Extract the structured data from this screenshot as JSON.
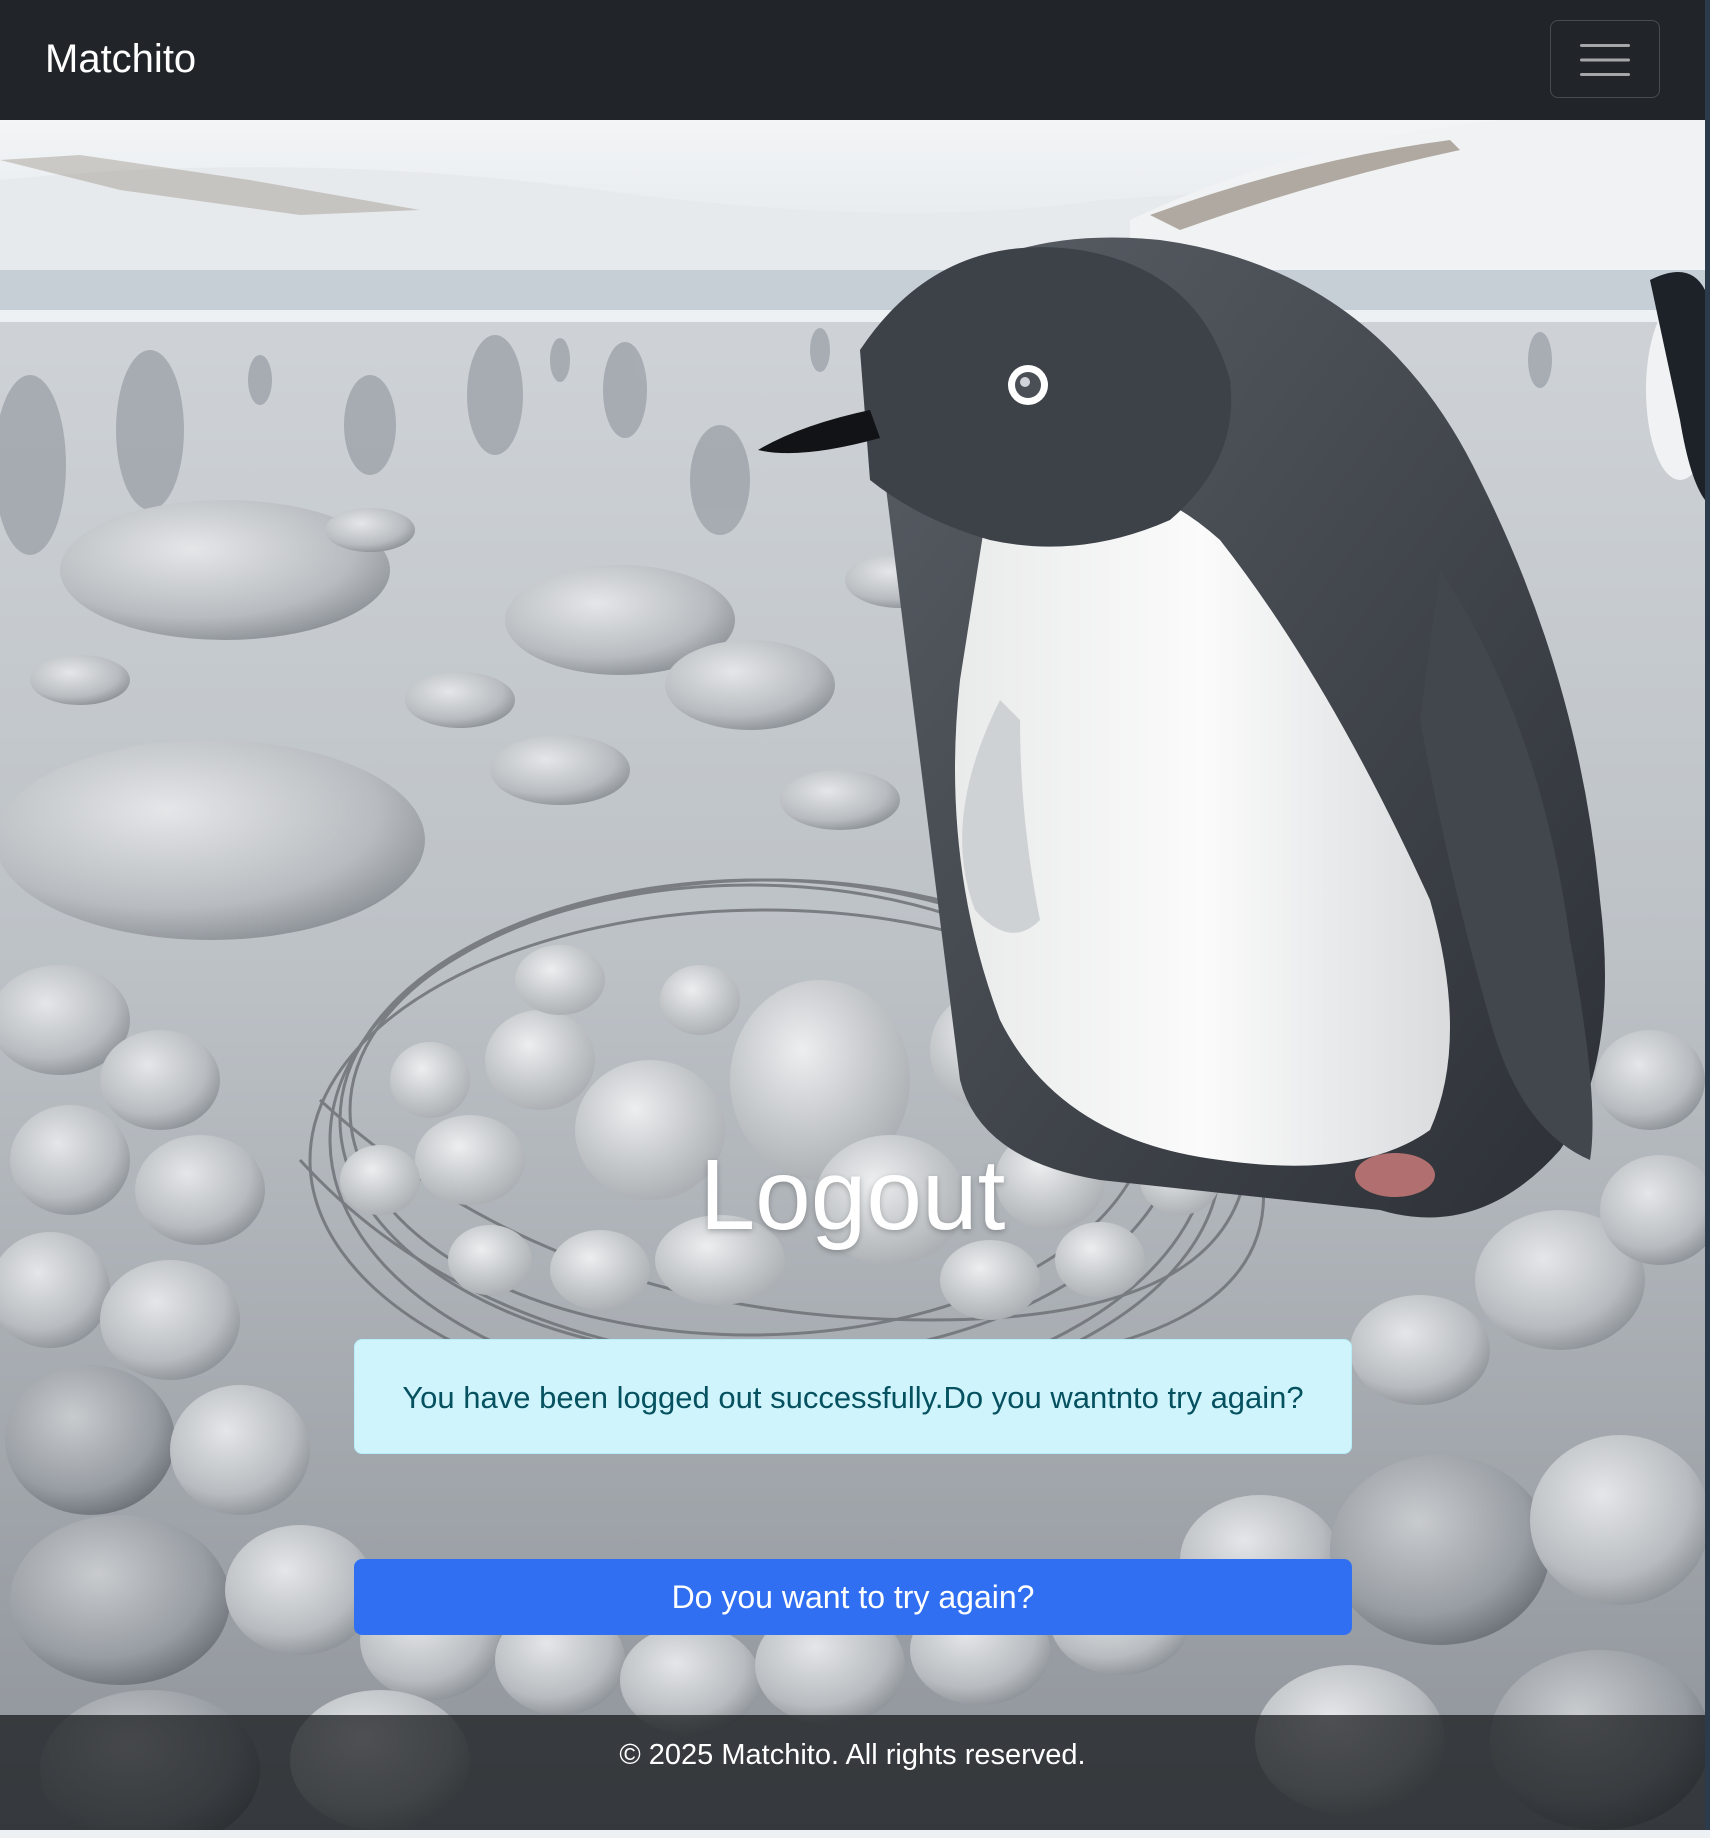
{
  "navbar": {
    "brand": "Matchito",
    "toggler_icon": "hamburger-menu-icon"
  },
  "hero": {
    "background_image": "penguin-with-pebble-nest-photo"
  },
  "main": {
    "title": "Logout",
    "alert_message": "You have been logged out successfully.Do you wantnto try again?",
    "retry_button_label": "Do you want to try again?"
  },
  "footer": {
    "copyright": "© 2025 Matchito. All rights reserved."
  },
  "colors": {
    "navbar_bg": "#212529",
    "alert_bg": "#cff4fc",
    "alert_text": "#055160",
    "button_bg": "#316ff2",
    "footer_bg": "#141619"
  }
}
